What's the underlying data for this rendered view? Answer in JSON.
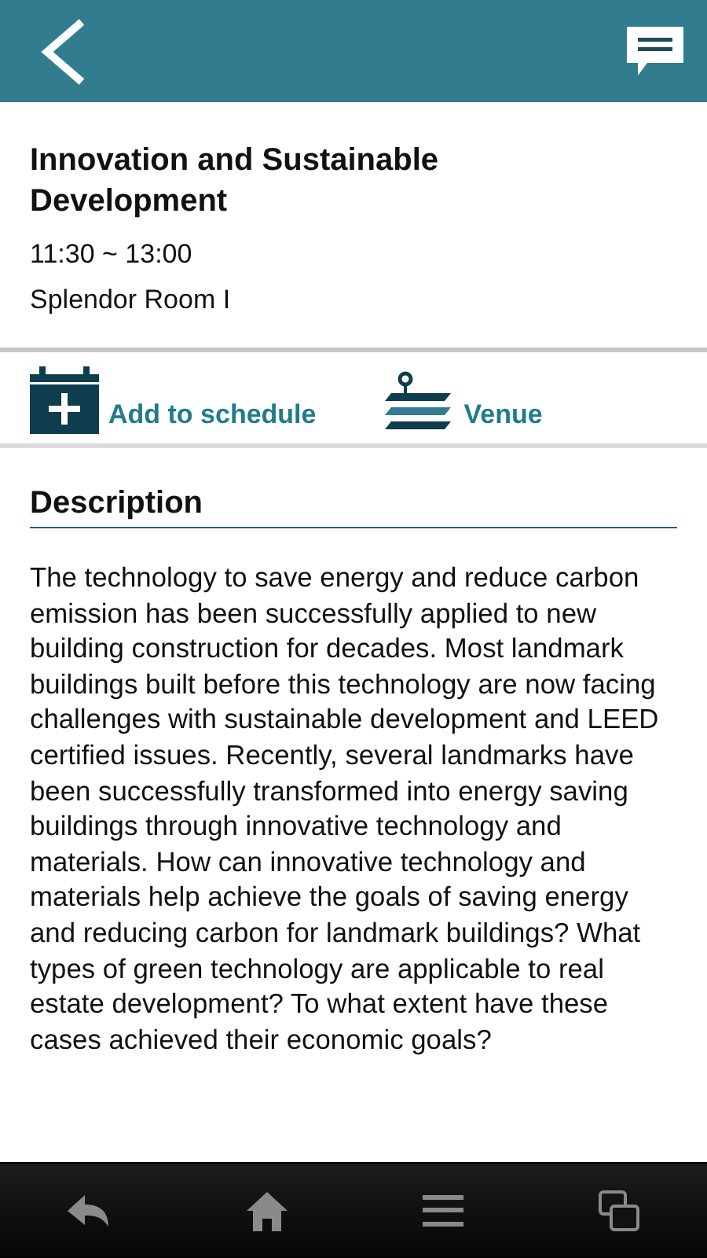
{
  "event": {
    "title": "Innovation and Sustainable Development",
    "time": "11:30 ~ 13:00",
    "room": "Splendor Room I"
  },
  "actions": [
    {
      "kind": "schedule",
      "label": "Add to schedule"
    },
    {
      "kind": "venue",
      "label": "Venue"
    }
  ],
  "description": {
    "heading": "Description",
    "text": "The technology to save energy and reduce carbon emission has been successfully applied to new building construction for decades. Most landmark buildings built before this technology are now facing challenges with sustainable development and LEED certified issues. Recently, several landmarks have been successfully transformed into energy saving buildings through innovative technology and materials. How can innovative technology and materials help achieve the goals of saving energy and reducing carbon for landmark buildings? What types of green technology are applicable to real estate development? To what extent have these cases achieved their economic goals?"
  },
  "nav": [
    {
      "kind": "back"
    },
    {
      "kind": "home"
    },
    {
      "kind": "menu"
    },
    {
      "kind": "recent"
    }
  ]
}
